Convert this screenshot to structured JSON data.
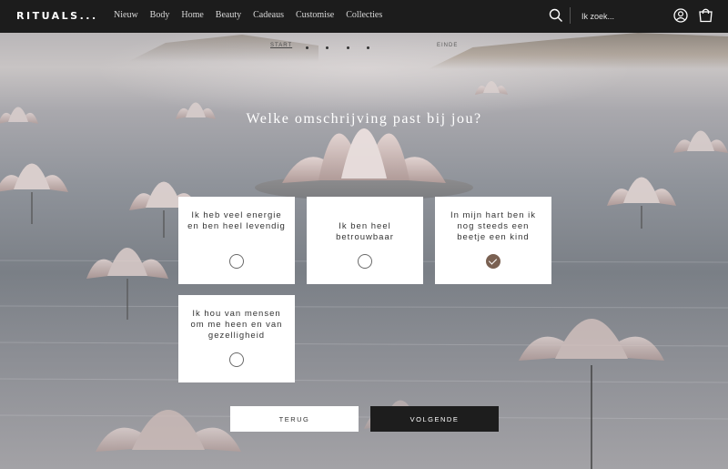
{
  "brand": {
    "logo": "RITUALS..."
  },
  "nav": {
    "items": [
      "Nieuw",
      "Body",
      "Home",
      "Beauty",
      "Cadeaus",
      "Customise",
      "Collecties"
    ]
  },
  "header": {
    "search_placeholder": "Ik zoek...",
    "icons": [
      "search-icon",
      "account-icon",
      "shopping-bag-icon"
    ]
  },
  "progress": {
    "start_label": "START",
    "end_label": "EINDE",
    "step_count": 4
  },
  "quiz": {
    "question": "Welke omschrijving past bij jou?",
    "options": [
      {
        "label": "Ik heb veel energie en ben heel levendig",
        "selected": false
      },
      {
        "label": "Ik ben heel betrouwbaar",
        "selected": false
      },
      {
        "label": "In mijn hart ben ik nog steeds een beetje een kind",
        "selected": true
      },
      {
        "label": "Ik hou van mensen om me heen en van gezelligheid",
        "selected": false
      }
    ]
  },
  "buttons": {
    "back": "TERUG",
    "next": "VOLGENDE"
  },
  "colors": {
    "header_bg": "#1c1c1c",
    "accent_selected": "#7a6152",
    "next_button_bg": "#1d1d1d"
  }
}
